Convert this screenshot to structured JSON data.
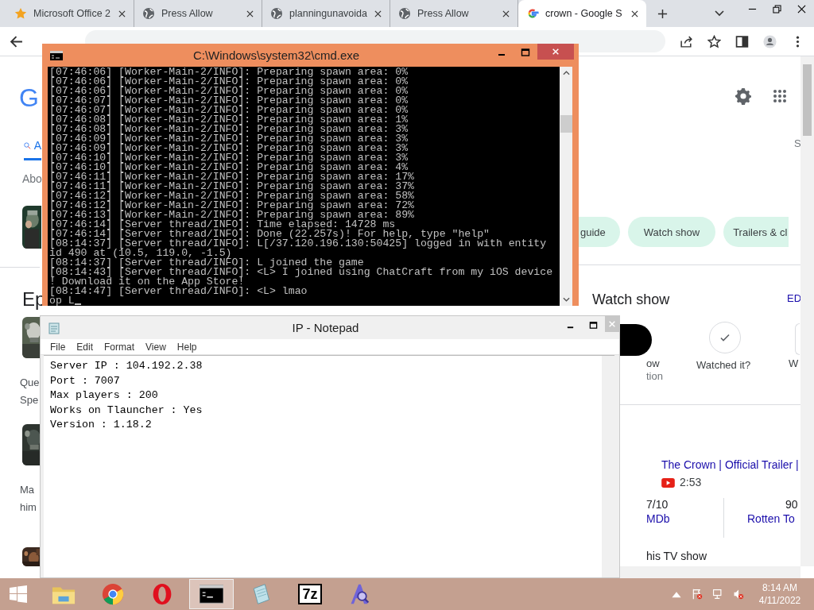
{
  "browser": {
    "tabs": [
      {
        "kind": "star",
        "title": "Microsoft Office 2",
        "selected": false
      },
      {
        "kind": "globe",
        "title": "Press Allow",
        "selected": false
      },
      {
        "kind": "globe",
        "title": "planningunavoida",
        "selected": false
      },
      {
        "kind": "globe",
        "title": "Press Allow",
        "selected": false
      },
      {
        "kind": "google",
        "title": "crown - Google S",
        "selected": true
      }
    ],
    "page": {
      "logo": "G",
      "search_tab": "A",
      "about": "Abo",
      "episodes_heading": "Ep",
      "episodes": [
        {
          "line_1": "Que",
          "line_2": "Spe"
        },
        {
          "line_1": "Ma",
          "line_2": "him"
        }
      ],
      "side_letter": "S",
      "chips": [
        "guide",
        "Watch show",
        "Trailers & cl"
      ],
      "watch_heading": "Watch show",
      "edit": "ED",
      "actions": [
        {
          "kind": "partial",
          "line_1": "ow",
          "line_2": "tion"
        },
        {
          "kind": "check",
          "line_1": "Watched it?"
        },
        {
          "kind": "cut",
          "line_1": "W"
        }
      ],
      "video": {
        "title": "The Crown | Official Trailer |",
        "duration": "2:53"
      },
      "ratings": [
        {
          "score": "7/10",
          "source": "MDb"
        },
        {
          "score": "90",
          "source": "Rotten To"
        }
      ],
      "footer": "his TV show"
    }
  },
  "cmd": {
    "title": "C:\\Windows\\system32\\cmd.exe",
    "lines": [
      "[07:46:06] [Worker-Main-2/INFO]: Preparing spawn area: 0%",
      "[07:46:06] [Worker-Main-2/INFO]: Preparing spawn area: 0%",
      "[07:46:06] [Worker-Main-2/INFO]: Preparing spawn area: 0%",
      "[07:46:07] [Worker-Main-2/INFO]: Preparing spawn area: 0%",
      "[07:46:07] [Worker-Main-2/INFO]: Preparing spawn area: 0%",
      "[07:46:08] [Worker-Main-2/INFO]: Preparing spawn area: 1%",
      "[07:46:08] [Worker-Main-2/INFO]: Preparing spawn area: 3%",
      "[07:46:09] [Worker-Main-2/INFO]: Preparing spawn area: 3%",
      "[07:46:09] [Worker-Main-2/INFO]: Preparing spawn area: 3%",
      "[07:46:10] [Worker-Main-2/INFO]: Preparing spawn area: 3%",
      "[07:46:10] [Worker-Main-2/INFO]: Preparing spawn area: 4%",
      "[07:46:11] [Worker-Main-2/INFO]: Preparing spawn area: 17%",
      "[07:46:11] [Worker-Main-2/INFO]: Preparing spawn area: 37%",
      "[07:46:12] [Worker-Main-2/INFO]: Preparing spawn area: 58%",
      "[07:46:12] [Worker-Main-2/INFO]: Preparing spawn area: 72%",
      "[07:46:13] [Worker-Main-2/INFO]: Preparing spawn area: 89%",
      "[07:46:14] [Server thread/INFO]: Time elapsed: 14728 ms",
      "[07:46:14] [Server thread/INFO]: Done (22.257s)! For help, type \"help\"",
      "[08:14:37] [Server thread/INFO]: L[/37.120.196.130:50425] logged in with entity",
      "id 490 at (10.5, 119.0, -1.5)",
      "[08:14:37] [Server thread/INFO]: L joined the game",
      "[08:14:43] [Server thread/INFO]: <L> I joined using ChatCraft from my iOS device",
      "! Download it on the App Store!",
      "[08:14:47] [Server thread/INFO]: <L> lmao"
    ],
    "input": "op L"
  },
  "notepad": {
    "title": "IP - Notepad",
    "menu": [
      "File",
      "Edit",
      "Format",
      "View",
      "Help"
    ],
    "lines": [
      "Server IP : 104.192.2.38",
      "Port : 7007",
      "Max players : 200",
      "Works on Tlauncher : Yes",
      "Version : 1.18.2"
    ]
  },
  "taskbar": {
    "apps": [
      {
        "kind": "explorer",
        "active": false
      },
      {
        "kind": "chrome",
        "active": false
      },
      {
        "kind": "opera",
        "active": false
      },
      {
        "kind": "cmd",
        "active": true
      },
      {
        "kind": "notepad",
        "active": false
      },
      {
        "kind": "archive",
        "label": "7z",
        "active": false
      },
      {
        "kind": "app",
        "active": false
      }
    ],
    "time": "8:14 AM",
    "date": "4/11/2022"
  }
}
